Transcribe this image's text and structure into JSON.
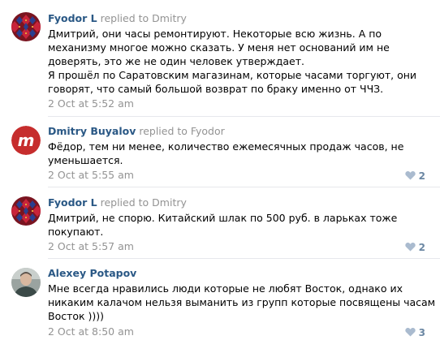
{
  "comments": [
    {
      "author": "Fyodor L",
      "reply_word": "replied to",
      "reply_to": "Dmitry",
      "avatar_icon": "red-pattern-avatar-icon",
      "lines": [
        "Дмитрий, они часы ремонтируют. Некоторые всю жизнь. А по",
        "механизму многое можно сказать. У меня нет оснований им не",
        "доверять, это же не один человек утверждает.",
        "Я прошёл по Саратовским магазинам, которые часами торгуют, они",
        "говорят, что самый большой возврат по браку именно от ЧЧЗ."
      ],
      "date": "2 Oct at 5:52 am",
      "likes": ""
    },
    {
      "author": "Dmitry Buyalov",
      "reply_word": "replied to",
      "reply_to": "Fyodor",
      "avatar_icon": "red-m-logo-avatar-icon",
      "avatar_letter": "m",
      "lines": [
        "Фёдор, тем ни менее, количество ежемесячных продаж часов, не",
        "уменьшается."
      ],
      "date": "2 Oct at 5:55 am",
      "likes": "2"
    },
    {
      "author": "Fyodor L",
      "reply_word": "replied to",
      "reply_to": "Dmitry",
      "avatar_icon": "red-pattern-avatar-icon",
      "lines": [
        "Дмитрий, не спорю. Китайский шлак по 500 руб. в ларьках тоже",
        "покупают."
      ],
      "date": "2 Oct at 5:57 am",
      "likes": "2"
    },
    {
      "author": "Alexey Potapov",
      "reply_word": "",
      "reply_to": "",
      "avatar_icon": "photo-avatar-icon",
      "lines": [
        "Мне всегда нравились люди которые не любят Восток, однако их",
        "никаким калачом нельзя выманить из групп которые посвящены часам",
        "Восток ))))"
      ],
      "date": "2 Oct at 8:50 am",
      "likes": "3"
    }
  ],
  "colors": {
    "author": "#2a5885",
    "muted": "#939393",
    "like": "#6b87a3",
    "divider": "#e7e8ec",
    "brand_red": "#c62d2d"
  }
}
